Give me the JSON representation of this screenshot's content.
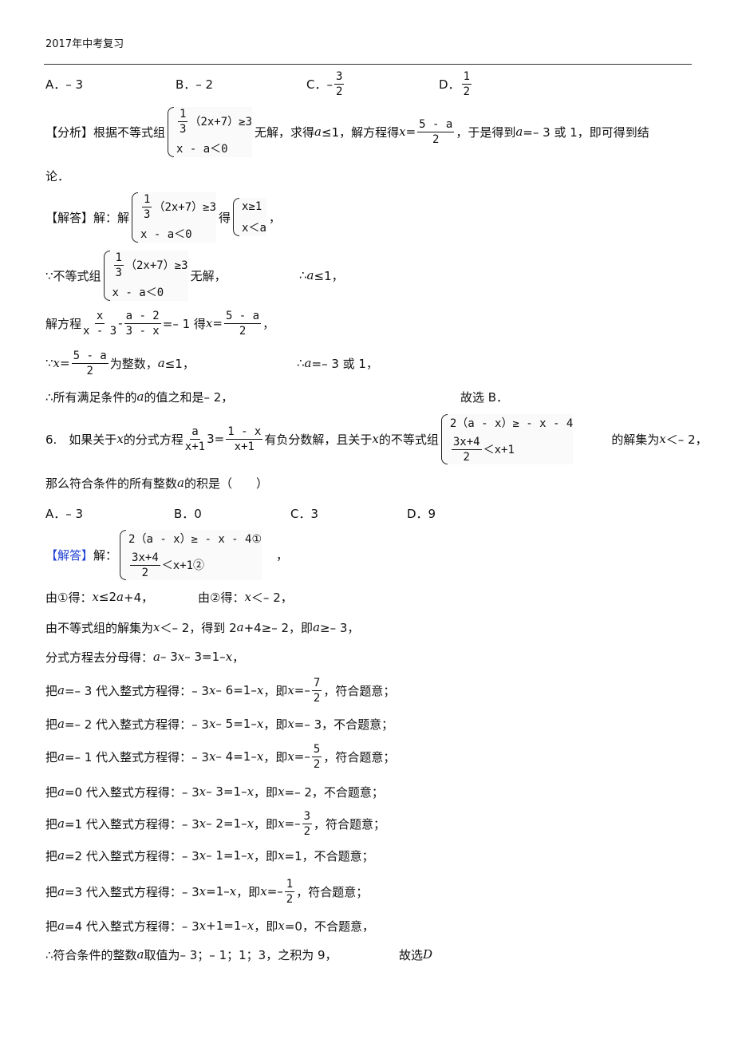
{
  "header": {
    "title": "2017年中考复习"
  },
  "lines": [
    [
      {
        "t": "A．– 3"
      }
    ],
    [
      {
        "t": "B．– 2"
      }
    ],
    [
      {
        "t": "C．–"
      },
      {
        "f": [
          "3",
          "2"
        ]
      }
    ],
    [
      {
        "t": "D．"
      },
      {
        "f": [
          "1",
          "2"
        ]
      }
    ],
    [
      {
        "t": "【分析】根据不等式组"
      },
      {
        "s": [
          [
            {
              "f": [
                "1",
                "3"
              ]
            },
            {
              "m": "（2x+7）≥3"
            }
          ],
          [
            {
              "m": "x - a＜0"
            }
          ]
        ]
      },
      {
        "t": "无解，求得 "
      },
      {
        "i": "a"
      },
      {
        "t": "≤1，解方程得 "
      },
      {
        "i": "x"
      },
      {
        "t": "="
      },
      {
        "f": [
          "5 - a",
          "2"
        ]
      },
      {
        "t": "，于是得到 "
      },
      {
        "i": "a"
      },
      {
        "t": "=– 3 或 1，即可得到结"
      }
    ],
    [
      {
        "t": "论．"
      }
    ],
    [
      {
        "t": "【解答】解：解"
      },
      {
        "s": [
          [
            {
              "f": [
                "1",
                "3"
              ]
            },
            {
              "m": "（2x+7）≥3"
            }
          ],
          [
            {
              "m": "x - a＜0"
            }
          ]
        ]
      },
      {
        "t": "得"
      },
      {
        "s": [
          [
            {
              "m": "x≥1"
            }
          ],
          [
            {
              "m": "x＜a"
            }
          ]
        ]
      },
      {
        "t": "，"
      }
    ],
    [
      {
        "t": "∵不等式组"
      },
      {
        "s": [
          [
            {
              "f": [
                "1",
                "3"
              ]
            },
            {
              "m": "（2x+7）≥3"
            }
          ],
          [
            {
              "m": "x - a＜0"
            }
          ]
        ]
      },
      {
        "t": "无解，"
      }
    ],
    [
      {
        "t": "∴"
      },
      {
        "i": "a"
      },
      {
        "t": "≤1，"
      }
    ],
    [
      {
        "t": "解方程"
      },
      {
        "f": [
          "x",
          "x - 3"
        ]
      },
      {
        "t": "- "
      },
      {
        "f": [
          "a - 2",
          "3 - x"
        ]
      },
      {
        "t": "=– 1 得 "
      },
      {
        "i": "x"
      },
      {
        "t": "="
      },
      {
        "f": [
          "5 - a",
          "2"
        ]
      },
      {
        "t": "，"
      }
    ],
    [
      {
        "t": "∵"
      },
      {
        "i": "x"
      },
      {
        "t": "="
      },
      {
        "f": [
          "5 - a",
          "2"
        ]
      },
      {
        "t": "为整数，"
      },
      {
        "i": "a"
      },
      {
        "t": "≤1，"
      }
    ],
    [
      {
        "t": "∴"
      },
      {
        "i": "a"
      },
      {
        "t": "=– 3 或 1，"
      }
    ],
    [
      {
        "t": "∴所有满足条件的 "
      },
      {
        "i": "a"
      },
      {
        "t": " 的值之和是– 2，"
      }
    ],
    [
      {
        "t": "故选 B．"
      }
    ],
    [
      {
        "t": "6.　如果关于 "
      },
      {
        "i": "x"
      },
      {
        "t": " 的分式方程"
      },
      {
        "f": [
          "a",
          "x+1"
        ]
      },
      {
        "t": " 3="
      },
      {
        "f": [
          "1 - x",
          "x+1"
        ]
      },
      {
        "t": "有负分数解，且关于 "
      },
      {
        "i": "x"
      },
      {
        "t": " 的不等式组"
      },
      {
        "s": [
          [
            {
              "m": "2（a - x）≥ - x - 4"
            }
          ],
          [
            {
              "f": [
                "3x+4",
                "2"
              ]
            },
            {
              "m": "＜x+1"
            }
          ]
        ]
      },
      {
        "t": "　　　的解集为 "
      },
      {
        "i": "x"
      },
      {
        "t": "＜– 2，"
      }
    ],
    [
      {
        "t": "那么符合条件的所有整数 "
      },
      {
        "i": "a"
      },
      {
        "t": " 的积是（　　）"
      }
    ],
    [
      {
        "t": "A．– 3"
      }
    ],
    [
      {
        "t": "B．0"
      }
    ],
    [
      {
        "t": "C．3"
      }
    ],
    [
      {
        "t": "D．9"
      }
    ],
    [
      {
        "b": "【解答】"
      },
      {
        "t": "解："
      },
      {
        "s": [
          [
            {
              "m": "2（a - x）≥ - x - 4①"
            }
          ],
          [
            {
              "f": [
                "3x+4",
                "2"
              ]
            },
            {
              "m": "＜x+1②"
            }
          ]
        ]
      },
      {
        "t": "　，"
      }
    ],
    [
      {
        "t": "由①得："
      },
      {
        "i": "x"
      },
      {
        "t": "≤2"
      },
      {
        "i": "a"
      },
      {
        "t": "+4，"
      }
    ],
    [
      {
        "t": "由②得："
      },
      {
        "i": "x"
      },
      {
        "t": "＜– 2，"
      }
    ],
    [
      {
        "t": "由不等式组的解集为 "
      },
      {
        "i": "x"
      },
      {
        "t": "＜– 2，得到 2"
      },
      {
        "i": "a"
      },
      {
        "t": "+4≥– 2，即 "
      },
      {
        "i": "a"
      },
      {
        "t": "≥– 3，"
      }
    ],
    [
      {
        "t": "分式方程去分母得："
      },
      {
        "i": "a"
      },
      {
        "t": "– 3"
      },
      {
        "i": "x"
      },
      {
        "t": "– 3=1– "
      },
      {
        "i": "x"
      },
      {
        "t": "，"
      }
    ],
    [
      {
        "t": "把 "
      },
      {
        "i": "a"
      },
      {
        "t": "=– 3 代入整式方程得：– 3"
      },
      {
        "i": "x"
      },
      {
        "t": "– 6=1– "
      },
      {
        "i": "x"
      },
      {
        "t": "，即 "
      },
      {
        "i": "x"
      },
      {
        "t": "=– "
      },
      {
        "f": [
          "7",
          "2"
        ]
      },
      {
        "t": "，符合题意；"
      }
    ],
    [
      {
        "t": "把 "
      },
      {
        "i": "a"
      },
      {
        "t": "=– 2 代入整式方程得：– 3"
      },
      {
        "i": "x"
      },
      {
        "t": "– 5=1– "
      },
      {
        "i": "x"
      },
      {
        "t": "，即 "
      },
      {
        "i": "x"
      },
      {
        "t": "=– 3，不合题意；"
      }
    ],
    [
      {
        "t": "把 "
      },
      {
        "i": "a"
      },
      {
        "t": "=– 1 代入整式方程得：– 3"
      },
      {
        "i": "x"
      },
      {
        "t": "– 4=1– "
      },
      {
        "i": "x"
      },
      {
        "t": "，即 "
      },
      {
        "i": "x"
      },
      {
        "t": "=– "
      },
      {
        "f": [
          "5",
          "2"
        ]
      },
      {
        "t": "，符合题意；"
      }
    ],
    [
      {
        "t": "把 "
      },
      {
        "i": "a"
      },
      {
        "t": "=0 代入整式方程得：– 3"
      },
      {
        "i": "x"
      },
      {
        "t": "– 3=1– "
      },
      {
        "i": "x"
      },
      {
        "t": "，即 "
      },
      {
        "i": "x"
      },
      {
        "t": "=– 2，不合题意；"
      }
    ],
    [
      {
        "t": "把 "
      },
      {
        "i": "a"
      },
      {
        "t": "=1 代入整式方程得：– 3"
      },
      {
        "i": "x"
      },
      {
        "t": "– 2=1– "
      },
      {
        "i": "x"
      },
      {
        "t": "，即 "
      },
      {
        "i": "x"
      },
      {
        "t": "=– "
      },
      {
        "f": [
          "3",
          "2"
        ]
      },
      {
        "t": "，符合题意；"
      }
    ],
    [
      {
        "t": "把 "
      },
      {
        "i": "a"
      },
      {
        "t": "=2 代入整式方程得：– 3"
      },
      {
        "i": "x"
      },
      {
        "t": "– 1=1– "
      },
      {
        "i": "x"
      },
      {
        "t": "，即 "
      },
      {
        "i": "x"
      },
      {
        "t": "=1，不合题意；"
      }
    ],
    [
      {
        "t": "把 "
      },
      {
        "i": "a"
      },
      {
        "t": "=3 代入整式方程得：– 3"
      },
      {
        "i": "x"
      },
      {
        "t": "=1– "
      },
      {
        "i": "x"
      },
      {
        "t": "，即 "
      },
      {
        "i": "x"
      },
      {
        "t": "=– "
      },
      {
        "f": [
          "1",
          "2"
        ]
      },
      {
        "t": "，符合题意；"
      }
    ],
    [
      {
        "t": "把 "
      },
      {
        "i": "a"
      },
      {
        "t": "=4 代入整式方程得：– 3"
      },
      {
        "i": "x"
      },
      {
        "t": "+1=1– "
      },
      {
        "i": "x"
      },
      {
        "t": "，即 "
      },
      {
        "i": "x"
      },
      {
        "t": "=0，不合题意，"
      }
    ],
    [
      {
        "t": "∴符合条件的整数 "
      },
      {
        "i": "a"
      },
      {
        "t": " 取值为– 3；– 1；1；3，之积为 9，"
      }
    ],
    [
      {
        "t": "故选 "
      },
      {
        "i": "D"
      }
    ]
  ],
  "colors": {
    "answer_label": "#1f3fd6"
  }
}
